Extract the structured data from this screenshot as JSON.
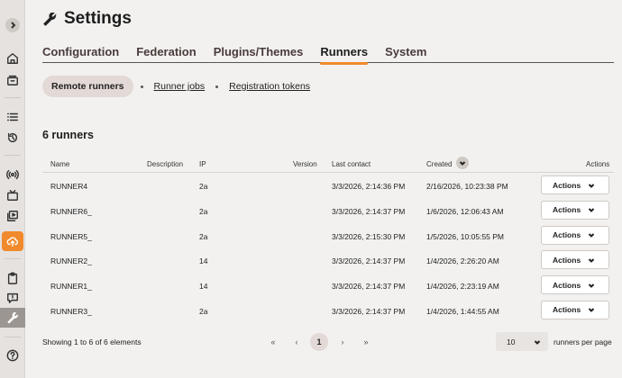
{
  "page": {
    "title": "Settings"
  },
  "tabs": [
    "Configuration",
    "Federation",
    "Plugins/Themes",
    "Runners",
    "System"
  ],
  "subnav": {
    "active": "Remote runners",
    "links": [
      "Runner jobs",
      "Registration tokens"
    ]
  },
  "summary": {
    "count_label": "6 runners"
  },
  "table": {
    "columns": {
      "name": "Name",
      "description": "Description",
      "ip": "IP",
      "version": "Version",
      "last_contact": "Last contact",
      "created": "Created",
      "actions": "Actions"
    },
    "rows": [
      {
        "name": "RUNNER4",
        "ip": "2a",
        "last_contact": "3/3/2026, 2:14:36 PM",
        "created": "2/16/2026, 10:23:38 PM",
        "action": "Actions"
      },
      {
        "name": "RUNNER6_",
        "ip": "2a",
        "last_contact": "3/3/2026, 2:14:37 PM",
        "created": "1/6/2026, 12:06:43 AM",
        "action": "Actions"
      },
      {
        "name": "RUNNER5_",
        "ip": "2a",
        "last_contact": "3/3/2026, 2:15:30 PM",
        "created": "1/5/2026, 10:05:55 PM",
        "action": "Actions"
      },
      {
        "name": "RUNNER2_",
        "ip": "14",
        "last_contact": "3/3/2026, 2:14:37 PM",
        "created": "1/4/2026, 2:26:20 AM",
        "action": "Actions"
      },
      {
        "name": "RUNNER1_",
        "ip": "14",
        "last_contact": "3/3/2026, 2:14:37 PM",
        "created": "1/4/2026, 2:23:19 AM",
        "action": "Actions"
      },
      {
        "name": "RUNNER3_",
        "ip": "2a",
        "last_contact": "3/3/2026, 2:14:37 PM",
        "created": "1/4/2026, 1:44:55 AM",
        "action": "Actions"
      }
    ]
  },
  "footer": {
    "showing": "Showing 1 to 6 of 6 elements",
    "pagination": {
      "first": "«",
      "prev": "‹",
      "current": "1",
      "next": "›",
      "last": "»"
    },
    "per_page_value": "10",
    "per_page_label": "runners per page"
  },
  "colors": {
    "accent": "#f08a2c",
    "pill_bg": "#e3d9d6",
    "background": "#f2f1f0"
  }
}
